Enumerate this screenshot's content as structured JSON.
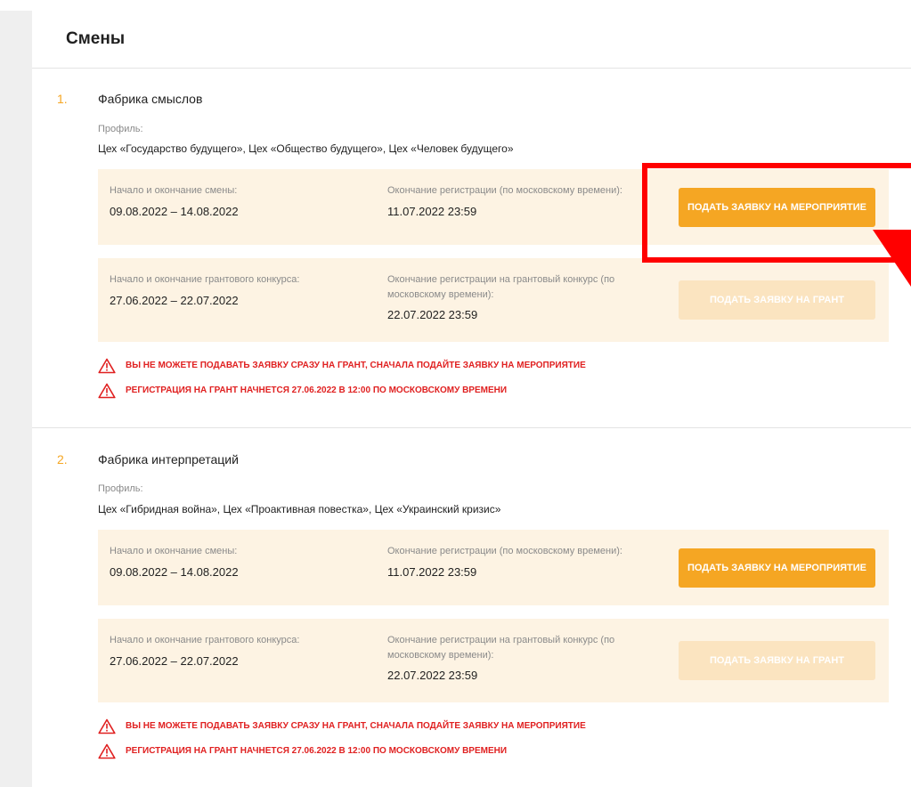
{
  "page": {
    "title": "Смены"
  },
  "shifts": [
    {
      "number": "1.",
      "title": "Фабрика смыслов",
      "profile_label": "Профиль:",
      "profile_value": "Цех «Государство будущего»,  Цех «Общество будущего»,  Цех «Человек будущего»",
      "event": {
        "dates_label": "Начало и окончание смены:",
        "dates_value": "09.08.2022 – 14.08.2022",
        "reg_label": "Окончание регистрации (по московскому времени):",
        "reg_value": "11.07.2022 23:59",
        "button": "ПОДАТЬ ЗАЯВКУ НА МЕРОПРИЯТИЕ"
      },
      "grant": {
        "dates_label": "Начало и окончание грантового конкурса:",
        "dates_value": "27.06.2022 – 22.07.2022",
        "reg_label_1": "Окончание регистрации на грантовый конкурс (по",
        "reg_label_2": "московскому времени):",
        "reg_value": "22.07.2022 23:59",
        "button": "ПОДАТЬ ЗАЯВКУ НА ГРАНТ"
      },
      "warnings": [
        "ВЫ НЕ МОЖЕТЕ ПОДАВАТЬ ЗАЯВКУ СРАЗУ НА ГРАНТ, СНАЧАЛА ПОДАЙТЕ ЗАЯВКУ НА МЕРОПРИЯТИЕ",
        "РЕГИСТРАЦИЯ НА ГРАНТ НАЧНЕТСЯ 27.06.2022 В 12:00 ПО МОСКОВСКОМУ ВРЕМЕНИ"
      ]
    },
    {
      "number": "2.",
      "title": "Фабрика интерпретаций",
      "profile_label": "Профиль:",
      "profile_value": "Цех «Гибридная война»,  Цех «Проактивная повестка»,  Цех «Украинский кризис»",
      "event": {
        "dates_label": "Начало и окончание смены:",
        "dates_value": "09.08.2022 – 14.08.2022",
        "reg_label": "Окончание регистрации (по московскому времени):",
        "reg_value": "11.07.2022 23:59",
        "button": "ПОДАТЬ ЗАЯВКУ НА МЕРОПРИЯТИЕ"
      },
      "grant": {
        "dates_label": "Начало и окончание грантового конкурса:",
        "dates_value": "27.06.2022 – 22.07.2022",
        "reg_label_1": "Окончание регистрации на грантовый конкурс (по",
        "reg_label_2": "московскому времени):",
        "reg_value": "22.07.2022 23:59",
        "button": "ПОДАТЬ ЗАЯВКУ НА ГРАНТ"
      },
      "warnings": [
        "ВЫ НЕ МОЖЕТЕ ПОДАВАТЬ ЗАЯВКУ СРАЗУ НА ГРАНТ, СНАЧАЛА ПОДАЙТЕ ЗАЯВКУ НА МЕРОПРИЯТИЕ",
        "РЕГИСТРАЦИЯ НА ГРАНТ НАЧНЕТСЯ 27.06.2022 В 12:00 ПО МОСКОВСКОМУ ВРЕМЕНИ"
      ]
    }
  ],
  "icons": {
    "warning": "warning-triangle-icon",
    "annotation_arrow": "arrow-down-icon"
  },
  "colors": {
    "accent": "#f5a623",
    "accent_disabled": "#fbe4c0",
    "panel_bg": "#fdf3e3",
    "warning_red": "#e02020",
    "annotation_red": "#ff0000"
  }
}
